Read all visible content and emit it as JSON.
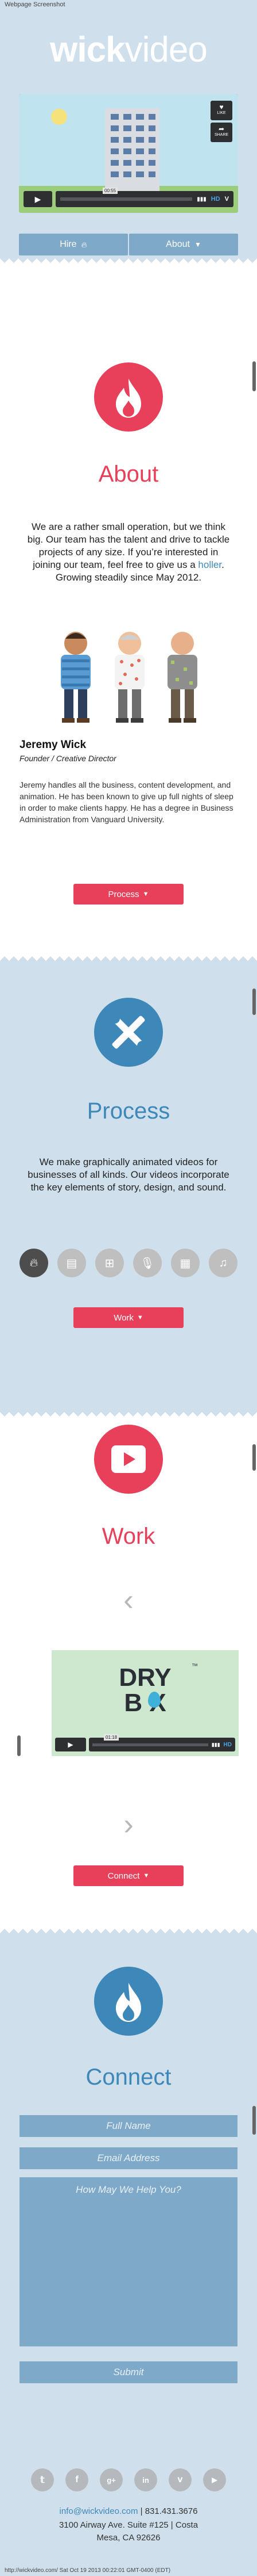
{
  "screenshot_label": "Webpage Screenshot",
  "brand": {
    "name_bold": "wick",
    "name_light": "video"
  },
  "hero": {
    "video": {
      "time": "00:55",
      "hd": "HD",
      "like": "LIKE",
      "share": "SHARE"
    },
    "hire_label": "Hire",
    "about_label": "About"
  },
  "about": {
    "title": "About",
    "text_before": "We are a rather small operation, but we think big. Our team has the talent and drive to tackle projects of any size. If you’re interested in joining our team, feel free to give us a ",
    "link": "holler",
    "text_after": ". Growing steadily since May 2012.",
    "person_name": "Jeremy Wick",
    "person_role": "Founder / Creative Director",
    "bio": "Jeremy handles all the business, content development, and animation. He has been known to give up full nights of sleep in order to make clients happy. He has a degree in Business Administration from Vanguard University.",
    "button": "Process"
  },
  "process": {
    "title": "Process",
    "text": "We make graphically animated videos for businesses of all kinds. Our videos incorporate the key elements of story, design, and sound.",
    "tools": [
      "flame-icon",
      "document-icon",
      "grid-icon",
      "microphone-icon",
      "film-icon",
      "music-note-icon"
    ],
    "button": "Work"
  },
  "work": {
    "title": "Work",
    "video": {
      "logo_top": "DRY",
      "logo_bottom": "B X",
      "tm": "™",
      "time": "01:18",
      "hd": "HD"
    },
    "button": "Connect"
  },
  "connect": {
    "title": "Connect",
    "name_placeholder": "Full Name",
    "email_placeholder": "Email Address",
    "message_placeholder": "How May We Help You?",
    "submit": "Submit"
  },
  "footer": {
    "social": [
      "twitter-icon",
      "facebook-icon",
      "google-plus-icon",
      "linkedin-icon",
      "vimeo-icon",
      "youtube-icon"
    ],
    "email": "info@wickvideo.com",
    "phone": " | 831.431.3676",
    "address": "3100 Airway Ave. Suite #125 | Costa Mesa, CA 92626",
    "capture_line": "http://wickvideo.com/ Sat Oct 19 2013 00:22:01 GMT-0400 (EDT)"
  },
  "colors": {
    "accent_red": "#e8405a",
    "accent_blue": "#3e88b9",
    "panel_blue": "#cfe0ec",
    "button_blue": "#7fa9c8"
  }
}
